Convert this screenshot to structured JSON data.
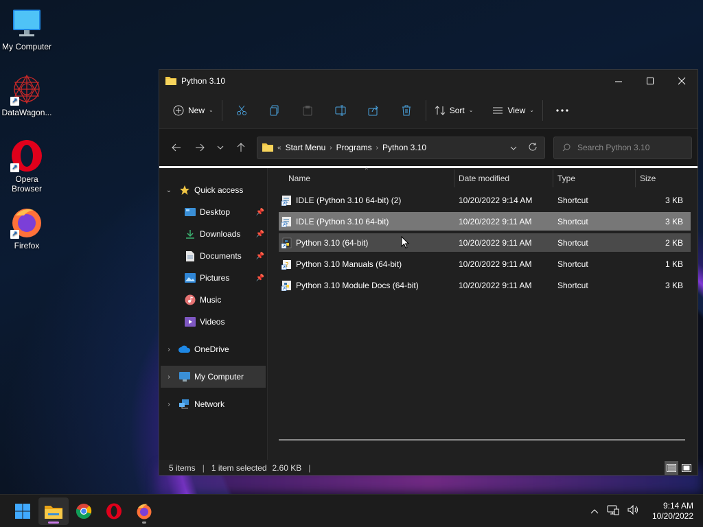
{
  "desktop": {
    "icons": [
      {
        "label": "My Computer",
        "icon": "monitor-icon"
      },
      {
        "label": "DataWagon...",
        "icon": "datawagon-icon"
      },
      {
        "label": "Opera Browser",
        "icon": "opera-icon"
      },
      {
        "label": "Firefox",
        "icon": "firefox-icon"
      }
    ]
  },
  "window": {
    "title": "Python 3.10",
    "toolbar": {
      "new_label": "New",
      "sort_label": "Sort",
      "view_label": "View"
    },
    "address": {
      "overflow": "«",
      "crumbs": [
        "Start Menu",
        "Programs",
        "Python 3.10"
      ]
    },
    "search": {
      "placeholder": "Search Python 3.10"
    },
    "nav": {
      "quick_access": "Quick access",
      "items": [
        "Desktop",
        "Downloads",
        "Documents",
        "Pictures",
        "Music",
        "Videos"
      ],
      "onedrive": "OneDrive",
      "my_computer": "My Computer",
      "network": "Network"
    },
    "columns": {
      "name": "Name",
      "date": "Date modified",
      "type": "Type",
      "size": "Size"
    },
    "files": [
      {
        "name": "IDLE (Python 3.10 64-bit) (2)",
        "date": "10/20/2022 9:14 AM",
        "type": "Shortcut",
        "size": "3 KB",
        "state": "normal"
      },
      {
        "name": "IDLE (Python 3.10 64-bit)",
        "date": "10/20/2022 9:11 AM",
        "type": "Shortcut",
        "size": "3 KB",
        "state": "selected"
      },
      {
        "name": "Python 3.10 (64-bit)",
        "date": "10/20/2022 9:11 AM",
        "type": "Shortcut",
        "size": "2 KB",
        "state": "hover"
      },
      {
        "name": "Python 3.10 Manuals (64-bit)",
        "date": "10/20/2022 9:11 AM",
        "type": "Shortcut",
        "size": "1 KB",
        "state": "normal"
      },
      {
        "name": "Python 3.10 Module Docs (64-bit)",
        "date": "10/20/2022 9:11 AM",
        "type": "Shortcut",
        "size": "3 KB",
        "state": "normal"
      }
    ],
    "status": {
      "count": "5 items",
      "selection": "1 item selected",
      "selection_size": "2.60 KB"
    }
  },
  "taskbar": {
    "apps": [
      "windows-start-icon",
      "file-explorer-icon",
      "chrome-icon",
      "opera-icon",
      "firefox-icon"
    ],
    "time": "9:14 AM",
    "date": "10/20/2022"
  },
  "colors": {
    "selected_row": "#777777",
    "hover_row": "#4a4a4a",
    "folder": "#f2c744",
    "accent": "#c87be6"
  }
}
